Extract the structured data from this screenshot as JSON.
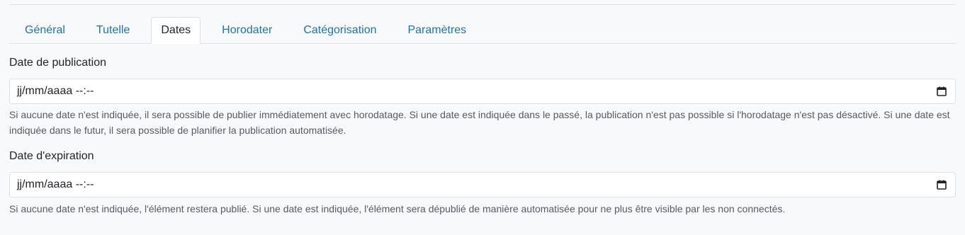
{
  "tabs": [
    {
      "label": "Général",
      "active": false
    },
    {
      "label": "Tutelle",
      "active": false
    },
    {
      "label": "Dates",
      "active": true
    },
    {
      "label": "Horodater",
      "active": false
    },
    {
      "label": "Catégorisation",
      "active": false
    },
    {
      "label": "Paramètres",
      "active": false
    }
  ],
  "publication": {
    "label": "Date de publication",
    "placeholder": "jj/mm/aaaa --:--",
    "help": "Si aucune date n'est indiquée, il sera possible de publier immédiatement avec horodatage. Si une date est indiquée dans le passé, la publication n'est pas possible si l'horodatage n'est pas désactivé. Si une date est indiquée dans le futur, il sera possible de planifier la publication automatisée."
  },
  "expiration": {
    "label": "Date d'expiration",
    "placeholder": "jj/mm/aaaa --:--",
    "help": "Si aucune date n'est indiquée, l'élément restera publié. Si une date est indiquée, l'élément sera dépublié de manière automatisée pour ne plus être visible par les non connectés."
  },
  "icons": {
    "calendar": "calendar-icon"
  },
  "colors": {
    "link": "#1a73b8",
    "background": "#f8f9fa",
    "border": "#dee2e6"
  }
}
